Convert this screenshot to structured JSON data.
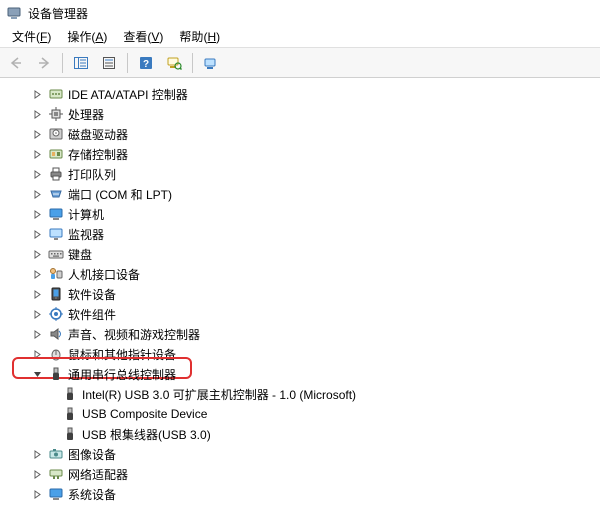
{
  "window": {
    "title": "设备管理器"
  },
  "menu": {
    "file": {
      "label": "文件",
      "hotkey": "F"
    },
    "action": {
      "label": "操作",
      "hotkey": "A"
    },
    "view": {
      "label": "查看",
      "hotkey": "V"
    },
    "help": {
      "label": "帮助",
      "hotkey": "H"
    }
  },
  "tree": {
    "ide": {
      "label": "IDE ATA/ATAPI 控制器"
    },
    "cpu": {
      "label": "处理器"
    },
    "disk": {
      "label": "磁盘驱动器"
    },
    "storage": {
      "label": "存储控制器"
    },
    "printq": {
      "label": "打印队列"
    },
    "ports": {
      "label": "端口 (COM 和 LPT)"
    },
    "computer": {
      "label": "计算机"
    },
    "monitor": {
      "label": "监视器"
    },
    "keyboard": {
      "label": "键盘"
    },
    "hid": {
      "label": "人机接口设备"
    },
    "swdev": {
      "label": "软件设备"
    },
    "swcomp": {
      "label": "软件组件"
    },
    "sound": {
      "label": "声音、视频和游戏控制器"
    },
    "mouse": {
      "label": "鼠标和其他指针设备"
    },
    "usb": {
      "label": "通用串行总线控制器"
    },
    "usb_child1": {
      "label": "Intel(R) USB 3.0 可扩展主机控制器 - 1.0 (Microsoft)"
    },
    "usb_child2": {
      "label": "USB Composite Device"
    },
    "usb_child3": {
      "label": "USB 根集线器(USB 3.0)"
    },
    "imaging": {
      "label": "图像设备"
    },
    "network": {
      "label": "网络适配器"
    },
    "system": {
      "label": "系统设备"
    }
  }
}
